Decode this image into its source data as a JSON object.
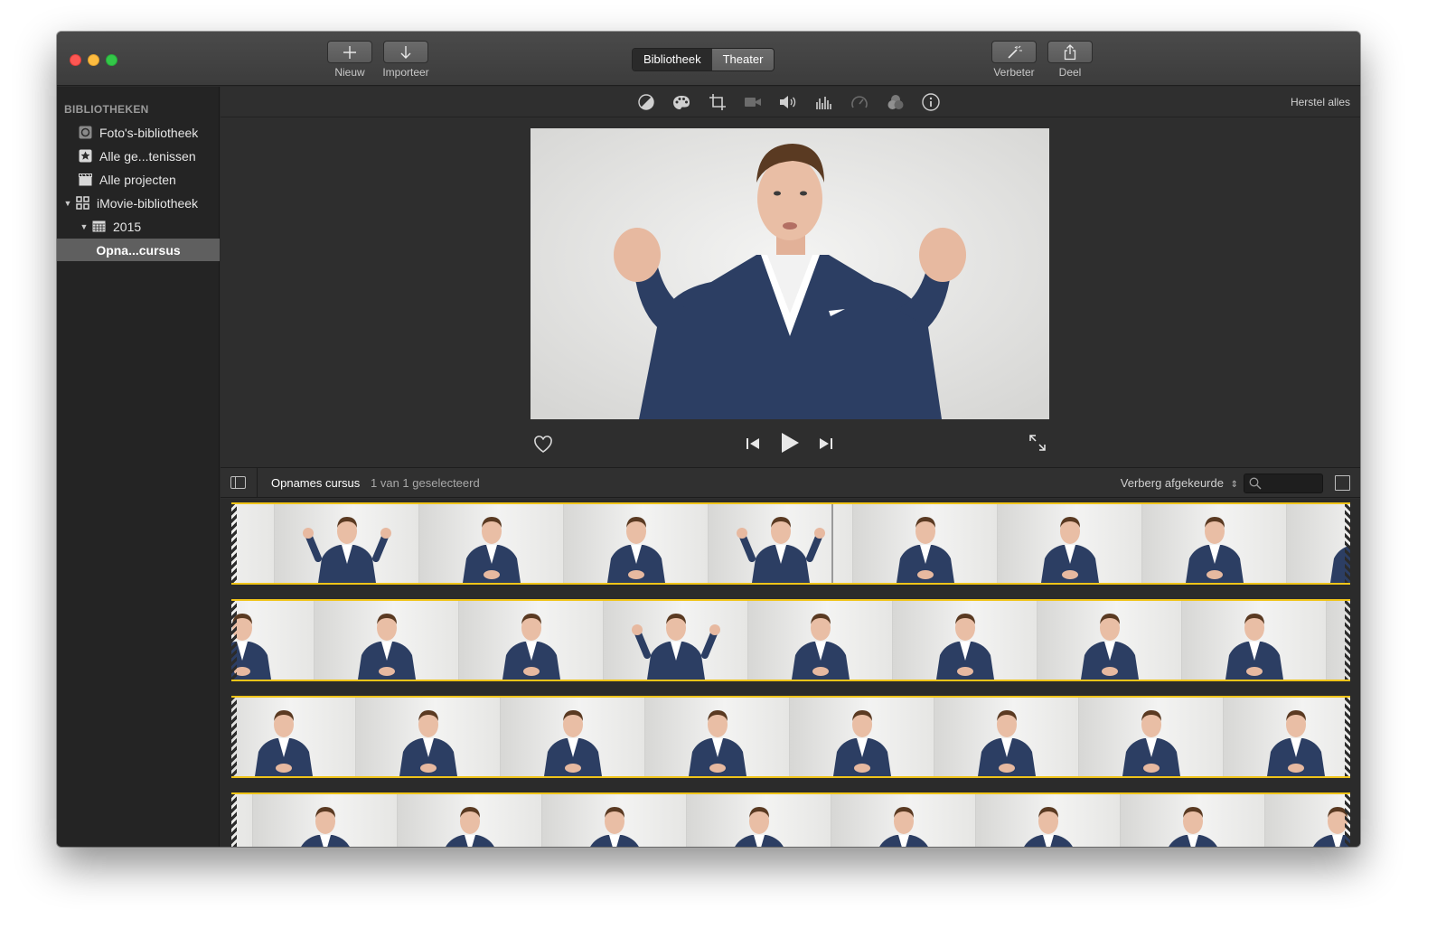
{
  "toolbar": {
    "new_label": "Nieuw",
    "import_label": "Importeer",
    "segment": [
      "Bibliotheek",
      "Theater"
    ],
    "enhance_label": "Verbeter",
    "share_label": "Deel"
  },
  "sidebar": {
    "heading": "BIBLIOTHEKEN",
    "items": [
      {
        "label": "Foto's-bibliotheek",
        "icon": "photos-icon"
      },
      {
        "label": "Alle ge...tenissen",
        "icon": "star-icon"
      },
      {
        "label": "Alle projecten",
        "icon": "clapper-icon"
      },
      {
        "label": "iMovie-bibliotheek",
        "icon": "grid-icon"
      },
      {
        "label": "2015",
        "icon": "calendar-icon"
      },
      {
        "label": "Opna...cursus",
        "icon": ""
      }
    ]
  },
  "adjust_bar": {
    "icons": [
      "color-balance-icon",
      "color-correction-icon",
      "crop-icon",
      "stabilization-icon",
      "volume-icon",
      "equalizer-icon",
      "speed-icon",
      "filter-icon",
      "info-icon"
    ],
    "reset_label": "Herstel alles"
  },
  "browser": {
    "event_title": "Opnames cursus",
    "selection_count": "1 van 1 geselecteerd",
    "filter_label": "Verberg afgekeurde",
    "search_placeholder": ""
  },
  "colors": {
    "accent_yellow": "#f0c419",
    "window_bg": "#2b2b2b",
    "suit": "#2c3e63"
  }
}
